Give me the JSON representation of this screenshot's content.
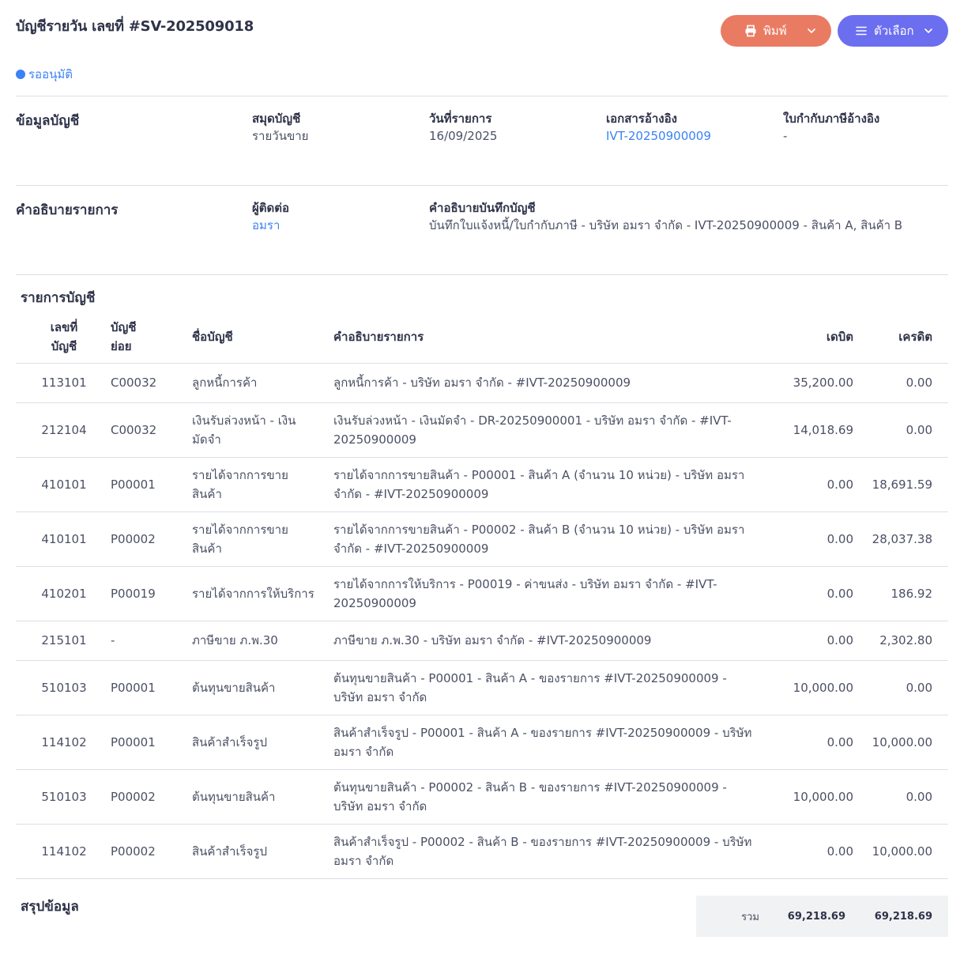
{
  "header": {
    "title": "บัญชีรายวัน เลขที่ #SV-202509018",
    "print_label": "พิมพ์",
    "options_label": "ตัวเลือก",
    "print_color": "#ea7b63",
    "options_color": "#6c6ef0"
  },
  "status": {
    "label": "รออนุมัติ",
    "color": "#3b82f6"
  },
  "account_info": {
    "section_title": "ข้อมูลบัญชี",
    "book_label": "สมุดบัญชี",
    "book_value": "รายวันขาย",
    "date_label": "วันที่รายการ",
    "date_value": "16/09/2025",
    "ref_doc_label": "เอกสารอ้างอิง",
    "ref_doc_value": "IVT-20250900009",
    "tax_ref_label": "ใบกำกับภาษีอ้างอิง",
    "tax_ref_value": "-"
  },
  "description": {
    "section_title": "คำอธิบายรายการ",
    "contact_label": "ผู้ติดต่อ",
    "contact_value": "อมรา",
    "memo_label": "คำอธิบายบันทึกบัญชี",
    "memo_value": "บันทึกใบแจ้งหนี้/ใบกำกับภาษี - บริษัท อมรา จำกัด - IVT-20250900009 - สินค้า A, สินค้า B"
  },
  "entries": {
    "section_title": "รายการบัญชี",
    "columns": {
      "account_no_1": "เลขที่",
      "account_no_2": "บัญชี",
      "sub_1": "บัญชี",
      "sub_2": "ย่อย",
      "name": "ชื่อบัญชี",
      "desc": "คำอธิบายรายการ",
      "debit": "เดบิต",
      "credit": "เครดิต"
    },
    "rows": [
      {
        "acc": "113101",
        "sub": "C00032",
        "name": "ลูกหนี้การค้า",
        "desc": "ลูกหนี้การค้า - บริษัท อมรา จำกัด - #IVT-20250900009",
        "debit": "35,200.00",
        "credit": "0.00"
      },
      {
        "acc": "212104",
        "sub": "C00032",
        "name": "เงินรับล่วงหน้า - เงินมัดจำ",
        "desc": "เงินรับล่วงหน้า - เงินมัดจำ - DR-20250900001 - บริษัท อมรา จำกัด - #IVT-20250900009",
        "debit": "14,018.69",
        "credit": "0.00"
      },
      {
        "acc": "410101",
        "sub": "P00001",
        "name": "รายได้จากการขายสินค้า",
        "desc": "รายได้จากการขายสินค้า - P00001 - สินค้า A (จำนวน 10 หน่วย) - บริษัท อมรา จำกัด - #IVT-20250900009",
        "debit": "0.00",
        "credit": "18,691.59"
      },
      {
        "acc": "410101",
        "sub": "P00002",
        "name": "รายได้จากการขายสินค้า",
        "desc": "รายได้จากการขายสินค้า - P00002 - สินค้า B (จำนวน 10 หน่วย) - บริษัท อมรา จำกัด - #IVT-20250900009",
        "debit": "0.00",
        "credit": "28,037.38"
      },
      {
        "acc": "410201",
        "sub": "P00019",
        "name": "รายได้จากการให้บริการ",
        "desc": "รายได้จากการให้บริการ - P00019 - ค่าขนส่ง - บริษัท อมรา จำกัด - #IVT-20250900009",
        "debit": "0.00",
        "credit": "186.92"
      },
      {
        "acc": "215101",
        "sub": "-",
        "name": "ภาษีขาย ภ.พ.30",
        "desc": "ภาษีขาย ภ.พ.30 - บริษัท อมรา จำกัด - #IVT-20250900009",
        "debit": "0.00",
        "credit": "2,302.80"
      },
      {
        "acc": "510103",
        "sub": "P00001",
        "name": "ต้นทุนขายสินค้า",
        "desc": "ต้นทุนขายสินค้า - P00001 - สินค้า A - ของรายการ #IVT-20250900009 - บริษัท อมรา จำกัด",
        "debit": "10,000.00",
        "credit": "0.00"
      },
      {
        "acc": "114102",
        "sub": "P00001",
        "name": "สินค้าสำเร็จรูป",
        "desc": "สินค้าสำเร็จรูป - P00001 - สินค้า A - ของรายการ #IVT-20250900009 - บริษัท อมรา จำกัด",
        "debit": "0.00",
        "credit": "10,000.00"
      },
      {
        "acc": "510103",
        "sub": "P00002",
        "name": "ต้นทุนขายสินค้า",
        "desc": "ต้นทุนขายสินค้า - P00002 - สินค้า B - ของรายการ #IVT-20250900009 - บริษัท อมรา จำกัด",
        "debit": "10,000.00",
        "credit": "0.00"
      },
      {
        "acc": "114102",
        "sub": "P00002",
        "name": "สินค้าสำเร็จรูป",
        "desc": "สินค้าสำเร็จรูป - P00002 - สินค้า B - ของรายการ #IVT-20250900009 - บริษัท อมรา จำกัด",
        "debit": "0.00",
        "credit": "10,000.00"
      }
    ]
  },
  "summary": {
    "section_title": "สรุปข้อมูล",
    "total_label": "รวม",
    "total_debit": "69,218.69",
    "total_credit": "69,218.69"
  },
  "icons": {
    "print": "printer-icon",
    "options": "menu-icon",
    "dropdown": "chevron-down-icon"
  }
}
